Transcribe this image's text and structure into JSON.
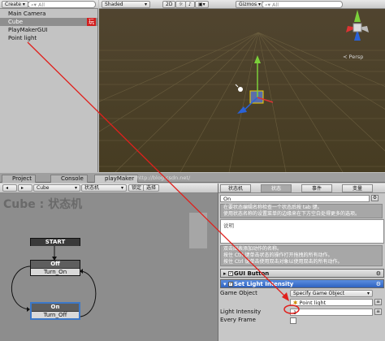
{
  "hierarchy": {
    "create_label": "Create",
    "search_placeholder": "All",
    "items": [
      {
        "label": "Main Camera",
        "selected": false
      },
      {
        "label": "Cube",
        "selected": true,
        "badge": "玩"
      },
      {
        "label": "PlayMakerGUI",
        "selected": false
      },
      {
        "label": "Point light",
        "selected": false
      }
    ]
  },
  "scene": {
    "shading_mode": "Shaded",
    "mode_2d": "2D",
    "gizmos_label": "Gizmos",
    "search_placeholder": "All",
    "view_label": "Persp"
  },
  "bottom_tabs": [
    {
      "label": "Project",
      "active": false
    },
    {
      "label": "Console",
      "active": false
    },
    {
      "label": "playMaker",
      "active": true
    }
  ],
  "watermark": "http://blog.csdn.net/",
  "graph": {
    "object_select": "Cube",
    "fsm_select": "状态机",
    "lock_label": "锁定",
    "select_label": "选择",
    "title": "Cube : 状态机",
    "start_label": "START",
    "states": [
      {
        "name": "Off",
        "transition": "Turn_On",
        "selected": false
      },
      {
        "name": "On",
        "transition": "Turn_Off",
        "selected": true
      }
    ]
  },
  "inspector": {
    "tabs": [
      {
        "label": "状态机",
        "active": false
      },
      {
        "label": "状态",
        "active": true
      },
      {
        "label": "事件",
        "active": false
      },
      {
        "label": "变量",
        "active": false
      }
    ],
    "state_name": "On",
    "hint1": [
      "在要状态编辑名称检查一个状态后按 tab 键。",
      "使用状态名称的设置菜单的边缘来在下方空白处得更多的选项。"
    ],
    "description_placeholder": "说明",
    "hint2": [
      "双击图表添加动作的名称。",
      "按住 Ctrl 键单击状态的操作打开拖拽的所有动作。",
      "按住 Ctrl 键单击使用双击对象以使用双击的所有动作。"
    ],
    "actions": [
      {
        "title": "GUI Button",
        "enabled": true,
        "expanded": false
      },
      {
        "title": "Set Light Intensity",
        "enabled": true,
        "expanded": true
      }
    ],
    "params": {
      "game_object_label": "Game Object",
      "game_object_value": "Specify Game Object",
      "point_light_value": "Point light",
      "light_intensity_label": "Light Intensity",
      "light_intensity_value": "1",
      "every_frame_label": "Every Frame"
    }
  },
  "colors": {
    "annotation_red": "#e0201c",
    "selection_blue": "#3c78c8",
    "scene_ground": "#4a4026"
  }
}
